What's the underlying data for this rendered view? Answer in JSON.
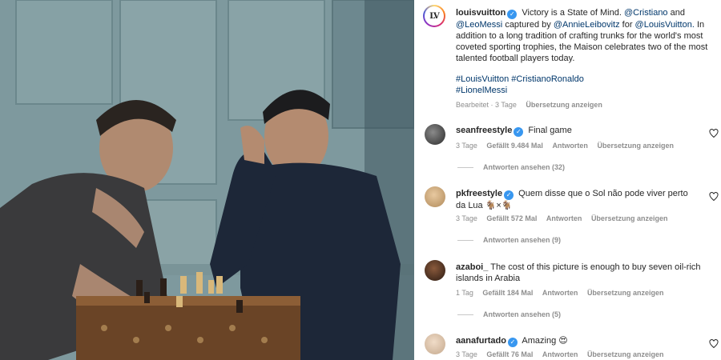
{
  "post": {
    "username": "louisvuitton",
    "caption_line1_after": "Victory is a State of Mind.",
    "mention_cristiano": "@Cristiano",
    "and": "and",
    "mention_messi": "@LeoMessi",
    "captured_by": "captured by",
    "mention_leibovitz": "@AnnieLeibovitz",
    "for": "for",
    "mention_lv": "@LouisVuitton.",
    "caption_rest": "In addition to a long tradition of crafting trunks for the world's most coveted sporting trophies, the Maison celebrates two of the most talented football players today.",
    "hashtags_line1": "#LouisVuitton #CristianoRonaldo",
    "hashtags_line2": "#LionelMessi",
    "edited": "Bearbeitet · 3 Tage",
    "translate": "Übersetzung anzeigen",
    "avatar_logo": "LV"
  },
  "comments": [
    {
      "username": "seanfreestyle",
      "verified": true,
      "text": "Final game",
      "time": "3 Tage",
      "likes": "Gefällt 9.484 Mal",
      "reply": "Antworten",
      "translate": "Übersetzung anzeigen",
      "view_replies": "Antworten ansehen (32)"
    },
    {
      "username": "pkfreestyle",
      "verified": true,
      "text_line1": "Quem disse que o Sol não pode viver perto da",
      "text_line2": "Lua 🐐×🐐",
      "time": "3 Tage",
      "likes": "Gefällt 572 Mal",
      "reply": "Antworten",
      "translate": "Übersetzung anzeigen",
      "view_replies": "Antworten ansehen (9)"
    },
    {
      "username": "azaboi_",
      "verified": false,
      "text_line1": "The cost of this picture is enough to buy seven oil-rich",
      "text_line2": "islands in Arabia",
      "time": "1 Tag",
      "likes": "Gefällt 184 Mal",
      "reply": "Antworten",
      "translate": "Übersetzung anzeigen",
      "view_replies": "Antworten ansehen (5)"
    },
    {
      "username": "aanafurtado",
      "verified": true,
      "text": "Amazing 😍",
      "time": "3 Tage",
      "likes": "Gefällt 76 Mal",
      "reply": "Antworten",
      "translate": "Übersetzung anzeigen"
    }
  ],
  "colors": {
    "link": "#00376b",
    "verified": "#3897f0",
    "meta": "#8e8e8e"
  },
  "icons": [
    "verified-badge-icon",
    "heart-icon"
  ]
}
